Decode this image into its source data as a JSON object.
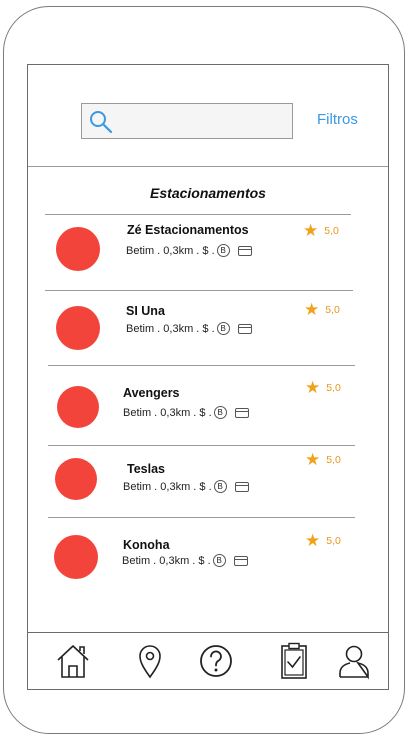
{
  "search": {
    "value": "",
    "placeholder": ""
  },
  "header": {
    "filters_label": "Filtros"
  },
  "section": {
    "title": "Estacionamentos"
  },
  "items": [
    {
      "name": "Zé Estacionamentos",
      "location": "Betim . 0,3km . $ .",
      "coin": "B",
      "rating": "5,0"
    },
    {
      "name": "SI Una",
      "location": "Betim . 0,3km . $ .",
      "coin": "B",
      "rating": "5,0"
    },
    {
      "name": "Avengers",
      "location": "Betim . 0,3km . $ .",
      "coin": "B",
      "rating": "5,0"
    },
    {
      "name": "Teslas",
      "location": "Betim . 0,3km . $ .",
      "coin": "B",
      "rating": "5,0"
    },
    {
      "name": "Konoha",
      "location": "Betim . 0,3km . $ .",
      "coin": "B",
      "rating": "5,0"
    }
  ],
  "tabbar": {
    "tabs": [
      "home-icon",
      "location-pin-icon",
      "help-icon",
      "clipboard-check-icon",
      "user-icon"
    ]
  },
  "colors": {
    "accent": "#3b98e3",
    "avatar": "#f2443a",
    "star": "#f0a21b"
  }
}
